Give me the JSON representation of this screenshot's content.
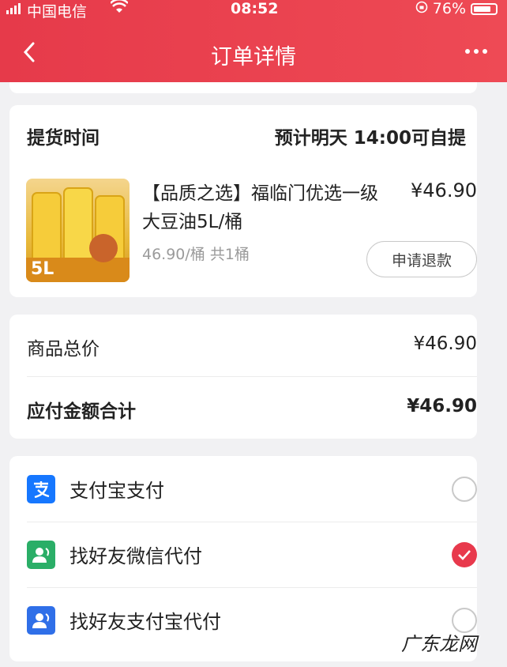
{
  "status_bar": {
    "carrier": "中国电信",
    "time": "08:52",
    "battery": "76%"
  },
  "header": {
    "title": "订单详情"
  },
  "pickup": {
    "label": "提货时间",
    "value": "预计明天 14:00可自提"
  },
  "product": {
    "name": "【品质之选】福临门优选一级大豆油5L/桶",
    "price": "¥46.90",
    "meta": "46.90/桶   共1桶",
    "refund_label": "申请退款",
    "image_text": "5L"
  },
  "totals": {
    "subtotal_label": "商品总价",
    "subtotal_value": "¥46.90",
    "payable_label": "应付金额合计",
    "payable_value": "¥46.90"
  },
  "payment_methods": [
    {
      "label": "支付宝支付",
      "icon": "alipay-icon",
      "selected": false
    },
    {
      "label": "找好友微信代付",
      "icon": "wechat-friend-icon",
      "selected": true
    },
    {
      "label": "找好友支付宝代付",
      "icon": "alipay-friend-icon",
      "selected": false
    }
  ],
  "watermark": "广东龙网",
  "colors": {
    "accent": "#e8394c",
    "header": "#ee4a55",
    "alipay": "#1677ff",
    "wechat": "#2aae67"
  }
}
